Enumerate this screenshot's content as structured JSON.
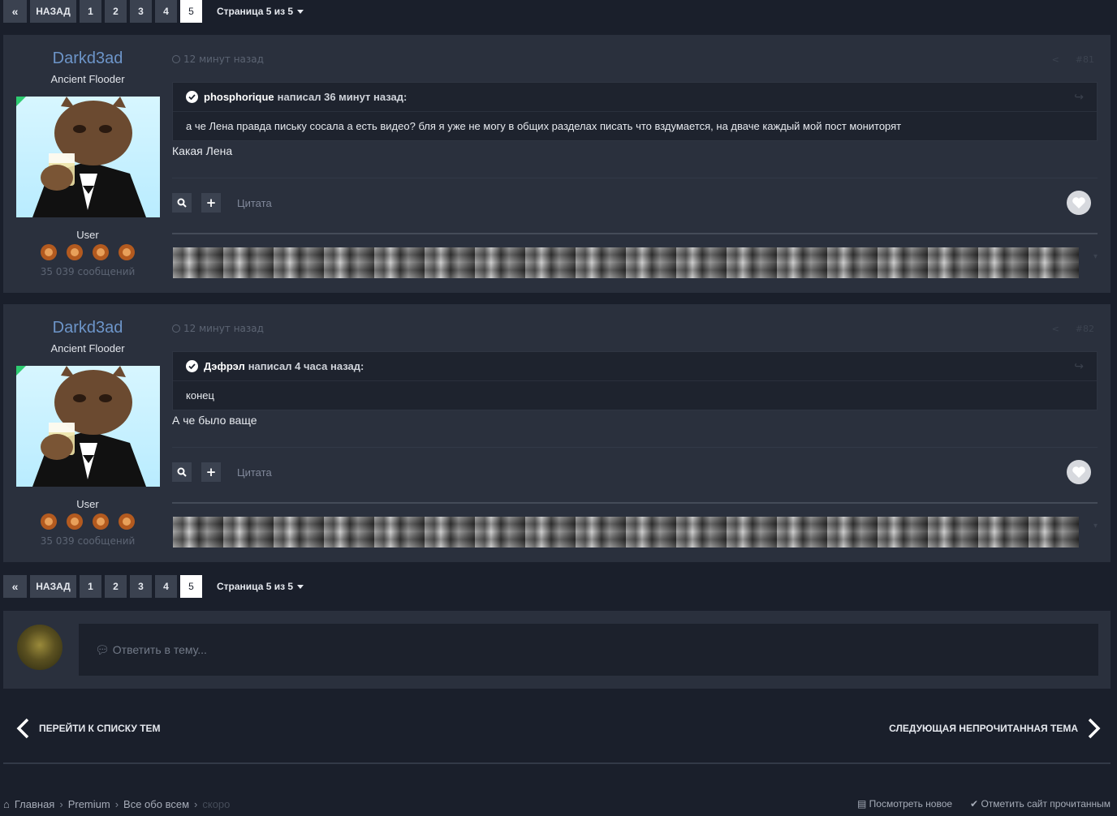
{
  "pagination": {
    "first_icon": "double-chevron-left-icon",
    "prev_label": "НАЗАД",
    "pages": [
      "1",
      "2",
      "3",
      "4",
      "5"
    ],
    "current_page": "5",
    "page_info": "Страница 5 из 5"
  },
  "posts": [
    {
      "author_name": "Darkd3ad",
      "author_title": "Ancient Flooder",
      "author_group": "User",
      "author_count": "35 039 сообщений",
      "time": "12 минут назад",
      "post_number": "#81",
      "quote": {
        "who": "phosphorique",
        "meta": "написал 36 минут назад:",
        "body": "а че Лена правда письку сосала а есть видео? бля я уже не могу в общих разделах писать что вздумается, на дваче каждый мой пост мониторят"
      },
      "content": "Какая Лена",
      "quote_label": "Цитата"
    },
    {
      "author_name": "Darkd3ad",
      "author_title": "Ancient Flooder",
      "author_group": "User",
      "author_count": "35 039 сообщений",
      "time": "12 минут назад",
      "post_number": "#82",
      "quote": {
        "who": "Дэфрэл",
        "meta": "написал 4 часа назад:",
        "body": "конец"
      },
      "content": "А че было ваще",
      "quote_label": "Цитата"
    }
  ],
  "reply": {
    "placeholder": "Ответить в тему..."
  },
  "navigation": {
    "prev_label": "ПЕРЕЙТИ К СПИСКУ ТЕМ",
    "next_label": "СЛЕДУЮЩАЯ НЕПРОЧИТАННАЯ ТЕМА"
  },
  "breadcrumb": {
    "items": [
      "Главная",
      "Premium",
      "Все обо всем",
      "скоро"
    ]
  },
  "footer": {
    "view_new": "Посмотреть новое",
    "mark_read": "Отметить сайт прочитанным"
  },
  "colors": {
    "background": "#1a1f2b",
    "panel": "#2a303d",
    "author_link": "#6d95c9",
    "button": "#3b4250"
  }
}
